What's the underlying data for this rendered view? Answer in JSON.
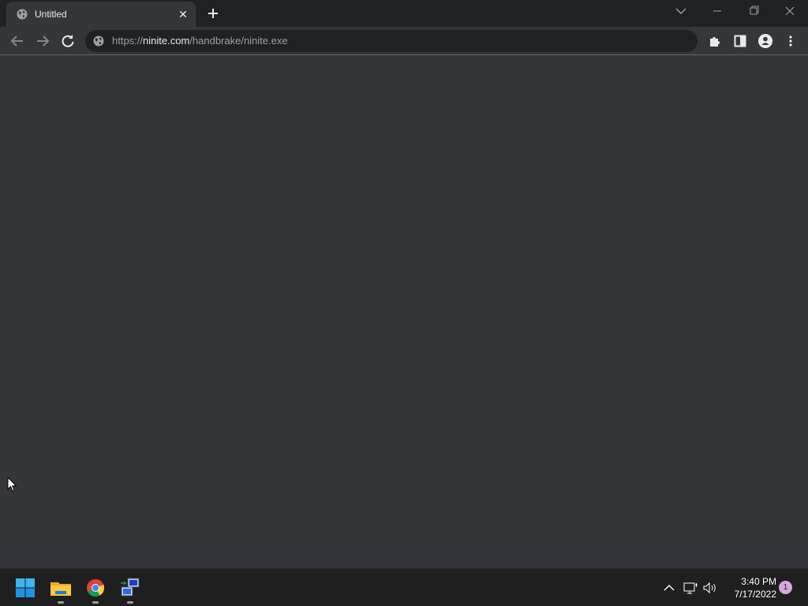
{
  "browser": {
    "tab": {
      "title": "Untitled",
      "favicon": "globe-icon"
    },
    "url": {
      "scheme": "https://",
      "host": "ninite.com",
      "path": "/handbrake/ninite.exe"
    },
    "colors": {
      "frame": "#202124",
      "toolbar": "#35363a",
      "text": "#e8eaed",
      "muted": "#9aa0a6"
    }
  },
  "taskbar": {
    "apps": [
      "windows-start-icon",
      "file-explorer-icon",
      "chrome-icon",
      "network-setup-icon"
    ],
    "clock": {
      "time": "3:40 PM",
      "date": "7/17/2022"
    },
    "notifications": "1"
  }
}
